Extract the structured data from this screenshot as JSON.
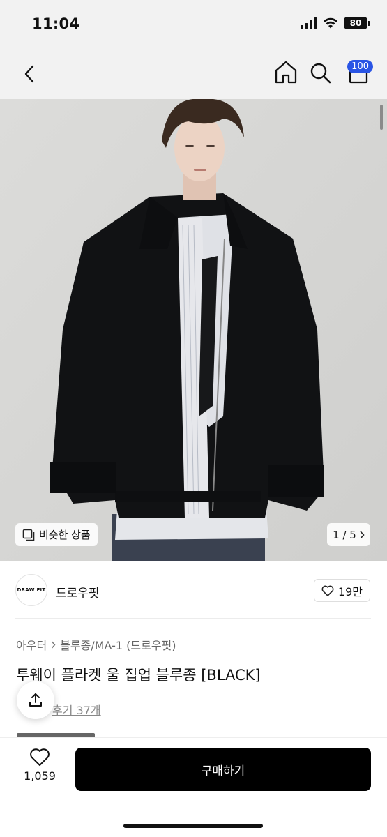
{
  "status_bar": {
    "time": "11:04",
    "battery": "80"
  },
  "nav": {
    "cart_badge": "100"
  },
  "product_image": {
    "similar_label": "비슷한 상품",
    "page_current": "1",
    "page_total": "5",
    "page_text": "1 / 5"
  },
  "brand": {
    "logo_text": "DRAW FIT",
    "name": "드로우핏",
    "likes": "19만"
  },
  "breadcrumb": {
    "level1": "아우터",
    "level2": "블루종/MA-1 (드로우핏)"
  },
  "product": {
    "title": "투웨이 플라켓 울 집업 블루종 [BLACK]",
    "review_text": "후기 37개"
  },
  "bottom": {
    "wish_count": "1,059",
    "buy_label": "구매하기"
  },
  "colors": {
    "accent": "#2a55e5",
    "buy_button": "#000000"
  }
}
